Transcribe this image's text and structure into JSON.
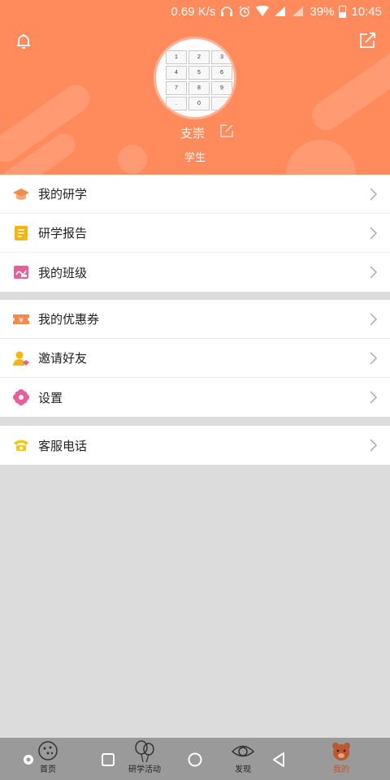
{
  "status_bar": {
    "speed": "0.69 K/s",
    "battery": "39%",
    "time": "10:45"
  },
  "header": {
    "username": "支崇",
    "role": "学生",
    "avatar_keys": [
      "1",
      "2",
      "3",
      "4",
      "5",
      "6",
      "7",
      "8",
      "9",
      ".",
      "0",
      ""
    ]
  },
  "menu": {
    "group1": [
      {
        "label": "我的研学",
        "icon": "graduation-cap-icon",
        "color": "#f28a4b"
      },
      {
        "label": "研学报告",
        "icon": "report-icon",
        "color": "#f5b40f"
      },
      {
        "label": "我的班级",
        "icon": "class-icon",
        "color": "#e8609a"
      }
    ],
    "group2": [
      {
        "label": "我的优惠券",
        "icon": "coupon-icon",
        "color": "#f28a4b"
      },
      {
        "label": "邀请好友",
        "icon": "invite-friend-icon",
        "color": "#f5b40f"
      },
      {
        "label": "设置",
        "icon": "settings-flower-icon",
        "color": "#e8609a"
      }
    ],
    "group3": [
      {
        "label": "客服电话",
        "icon": "phone-icon",
        "color": "#f5c518"
      }
    ]
  },
  "nav": {
    "items": [
      {
        "label": "首页",
        "icon": "home-cookie-icon"
      },
      {
        "label": "研学活动",
        "icon": "balloons-icon"
      },
      {
        "label": "发现",
        "icon": "eye-icon"
      },
      {
        "label": "我的",
        "icon": "bear-icon"
      }
    ],
    "active_color": "#c0572f"
  },
  "colors": {
    "header_bg": "#ff8a5b",
    "page_bg": "#dcdcdc"
  }
}
